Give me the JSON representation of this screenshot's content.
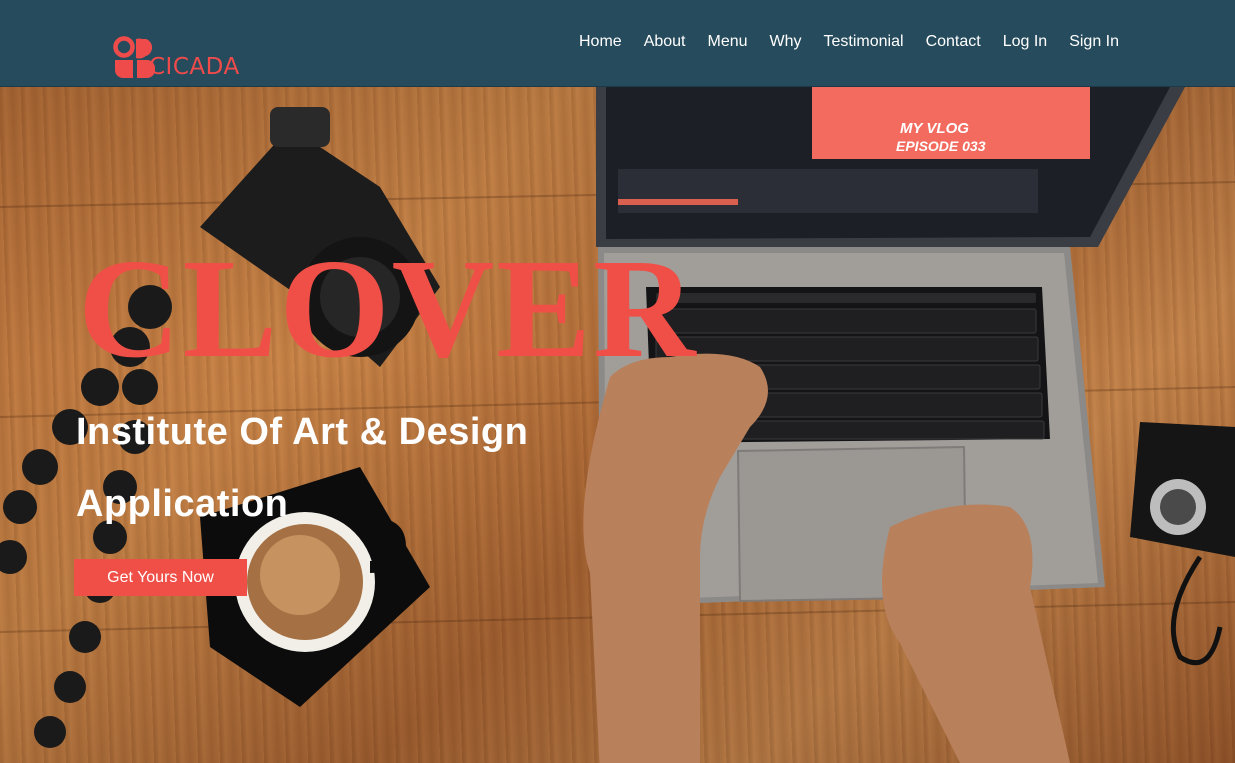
{
  "header": {
    "brand_name": "CICADA",
    "nav": [
      {
        "label": "Home"
      },
      {
        "label": "About"
      },
      {
        "label": "Menu"
      },
      {
        "label": "Why"
      },
      {
        "label": "Testimonial"
      },
      {
        "label": "Contact"
      },
      {
        "label": "Log In"
      },
      {
        "label": "Sign In"
      }
    ]
  },
  "hero": {
    "title": "CLOVER",
    "subtitle_line1": "Institute Of Art & Design",
    "subtitle_line2": "Application",
    "cta_label": "Get Yours Now",
    "laptop_screen_text_1": "MY VLOG",
    "laptop_screen_text_2": "EPISODE 033"
  },
  "colors": {
    "header_bg": "#264b5c",
    "accent": "#f04f47",
    "nav_text": "#ffffff"
  }
}
